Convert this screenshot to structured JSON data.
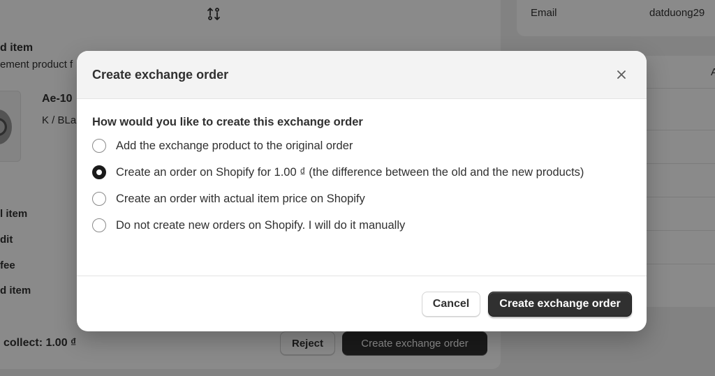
{
  "background": {
    "email_label": "Email",
    "email_value": "datduong29",
    "returned_heading": "d item",
    "returned_sub": "ement product f",
    "product_name": "Ae-10",
    "product_variant": "K / BLa",
    "summary_rows": [
      "l item",
      "dit",
      "fee",
      "d item"
    ],
    "collect_text": "collect: 1.00 ₫",
    "reject_label": "Reject",
    "create_label": "Create exchange order",
    "right_edge_text": "A"
  },
  "modal": {
    "title": "Create exchange order",
    "question": "How would you like to create this exchange order",
    "options": [
      {
        "label": "Add the exchange product to the original order",
        "selected": false
      },
      {
        "label": "Create an order on Shopify for 1.00 ₫ (the difference between the old and the new products)",
        "selected": true
      },
      {
        "label": "Create an order with actual item price on Shopify",
        "selected": false
      },
      {
        "label": "Do not create new orders on Shopify. I will do it manually",
        "selected": false
      }
    ],
    "cancel_label": "Cancel",
    "confirm_label": "Create exchange order"
  },
  "icons": {
    "close": "close-icon",
    "exchange": "exchange-arrows-icon"
  },
  "colors": {
    "primary_button": "#303030",
    "overlay": "rgba(0,0,0,0.46)",
    "modal_header": "#f3f3f3"
  }
}
